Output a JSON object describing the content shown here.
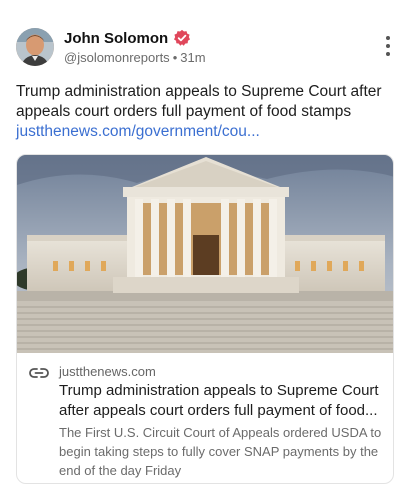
{
  "author": {
    "name": "John Solomon",
    "handle": "@jsolomonreports",
    "time": "31m",
    "verified_color": "#e0475b"
  },
  "post": {
    "text": "Trump administration appeals to Supreme Court after appeals court orders full payment of food stamps",
    "link": "justthenews.com/government/cou..."
  },
  "card": {
    "domain": "justthenews.com",
    "title": "Trump administration appeals to Supreme Court after appeals court orders full payment of food...",
    "description": "The First U.S. Circuit Court of Appeals ordered USDA to begin taking steps to fully cover SNAP payments by the end of the day Friday",
    "image_subject": "supreme-court-building"
  },
  "icons": {
    "menu": "more-vertical-icon",
    "link": "link-icon",
    "verified": "verified-badge-icon"
  },
  "colors": {
    "link": "#3b6fd1",
    "muted": "#6b6b6b"
  }
}
